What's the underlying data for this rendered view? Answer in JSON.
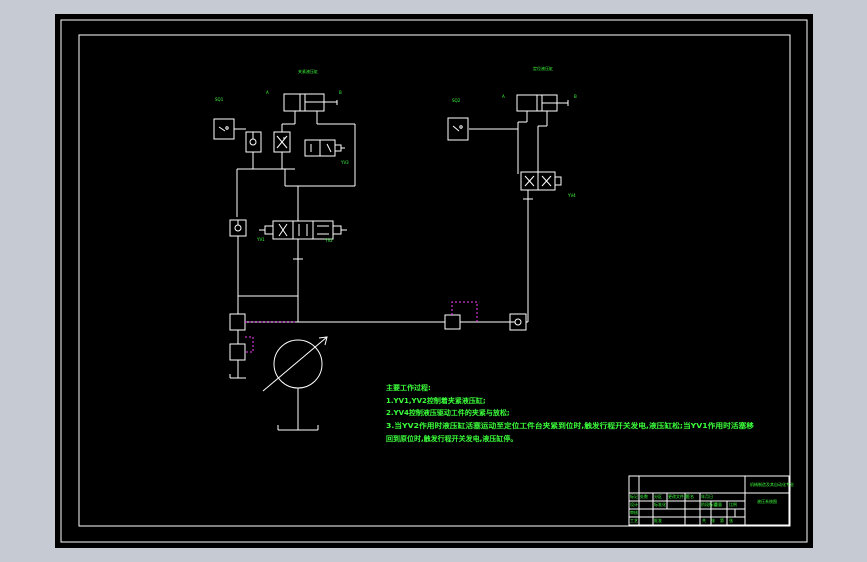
{
  "colors": {
    "background": "#c6cad3",
    "canvas": "#000000",
    "line": "#ffffff",
    "text": "#3cff3c",
    "dashed": "#ff3cff"
  },
  "labels": {
    "left_cylinder_title": "夹紧液压缸",
    "right_cylinder_title": "定位液压缸",
    "left_switch": "SQ1",
    "left_cylinder_a": "A",
    "left_cylinder_b": "B",
    "left_solenoid": "YV3",
    "left_valve_a": "YV1",
    "left_valve_b": "YV2",
    "right_switch": "SQ2",
    "right_cylinder_a": "A",
    "right_cylinder_b": "B",
    "right_solenoid": "YV4"
  },
  "notes": {
    "title": "主要工作过程:",
    "line1": "1.YV1,YV2控制着夹紧液压缸;",
    "line2": "2.YV4控制液压驱动工件的夹紧与放松;",
    "line3": "3.当YV2作用时液压缸活塞运动至定位工件台夹紧到位时,触发行程开关发电,液压缸松;当YV1作用时活塞移",
    "line4": "回到原位时,触发行程开关发电,液压缸停。"
  },
  "title_block": {
    "school": "机械制造及其自动化专业",
    "drawing_name": "液压系统图",
    "r1": [
      "标记",
      "处数",
      "分区",
      "更改文件号",
      "签名",
      "年月日"
    ],
    "r2": [
      "设计",
      "",
      "标准化",
      "",
      "阶段标记",
      "重量",
      "比例"
    ],
    "r3": [
      "审核",
      ""
    ],
    "r4": [
      "工艺",
      "",
      "批准",
      "",
      "共",
      "张",
      "第",
      "张"
    ]
  }
}
